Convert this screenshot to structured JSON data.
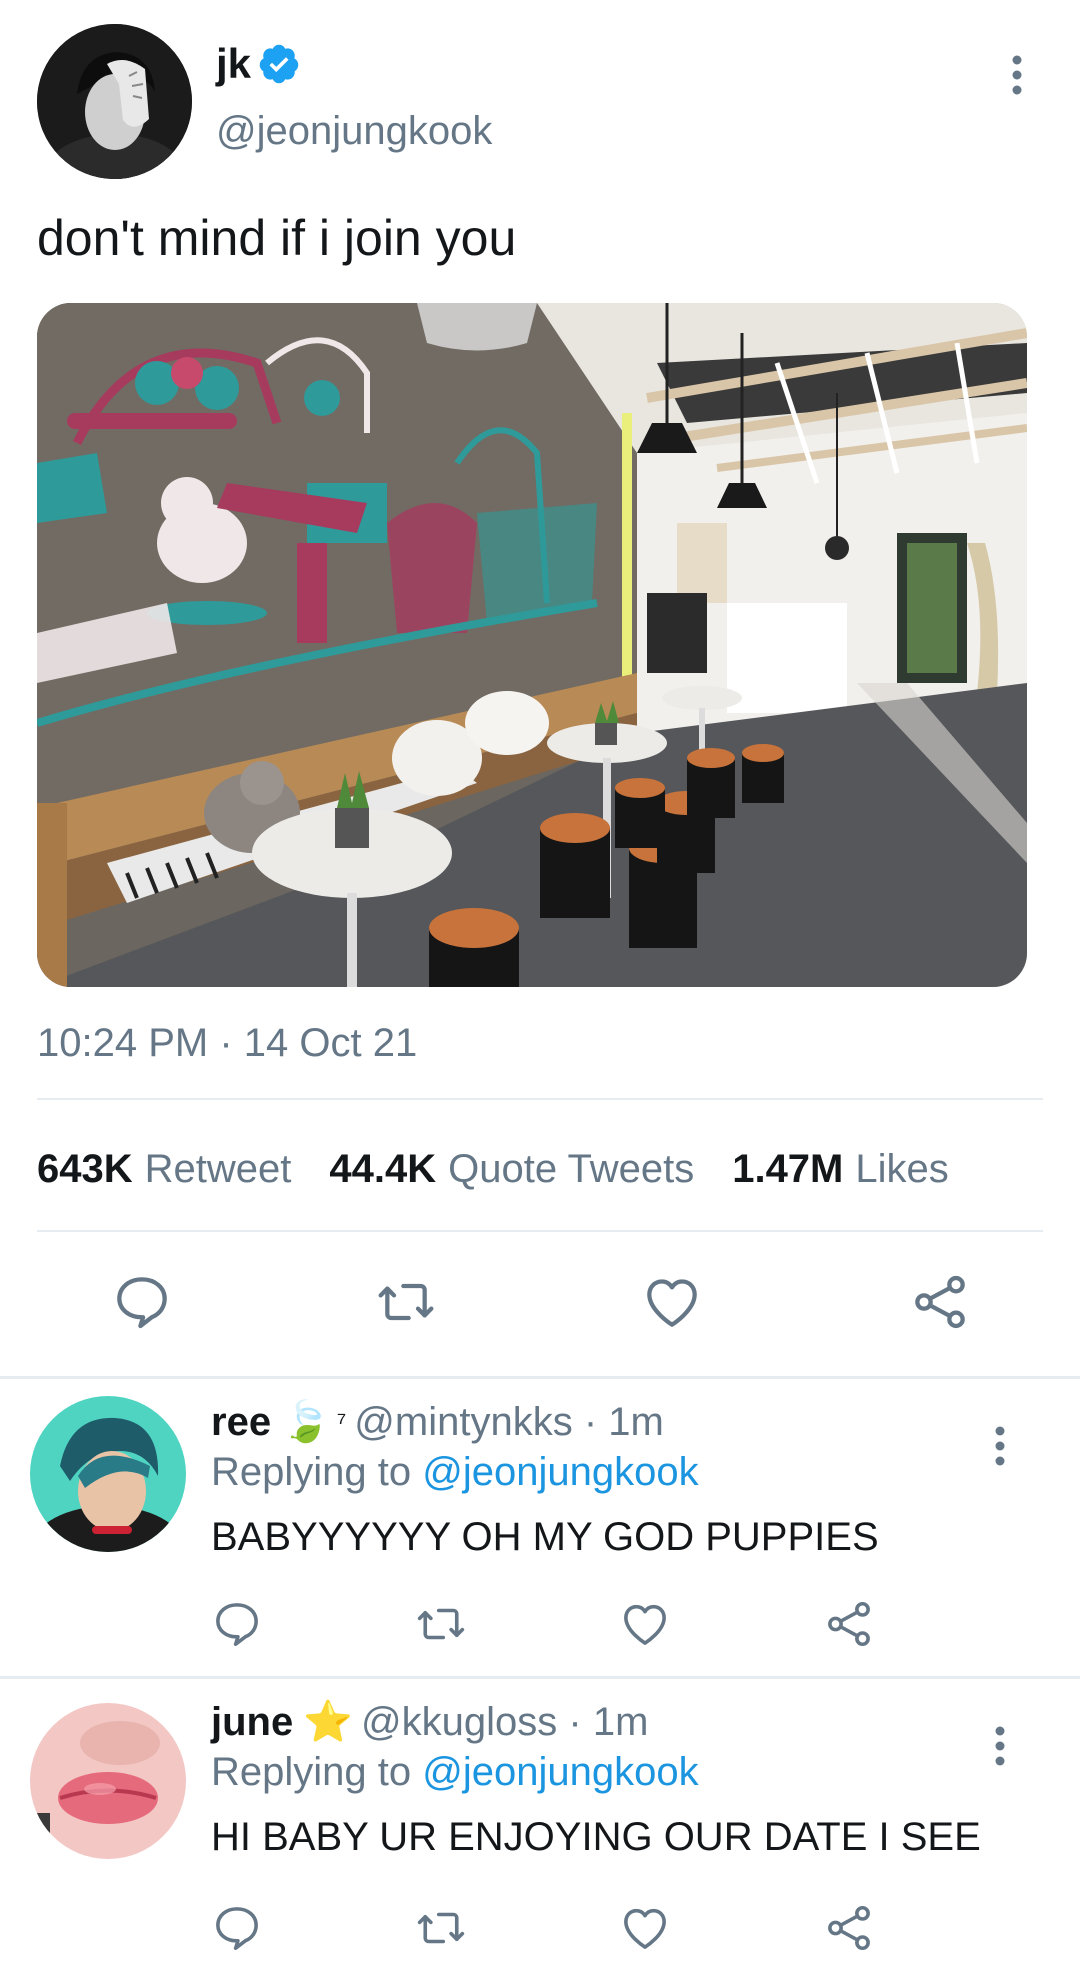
{
  "main_tweet": {
    "display_name": "jk",
    "verified_icon": "verified-badge-icon",
    "handle": "@jeonjungkook",
    "text": "don't mind if i join you",
    "timestamp": "10:24 PM · 14 Oct 21",
    "stats": {
      "retweets_count": "643K",
      "retweets_label": "Retweet",
      "quotes_count": "44.4K",
      "quotes_label": "Quote Tweets",
      "likes_count": "1.47M",
      "likes_label": "Likes"
    },
    "actions": [
      "reply-icon",
      "retweet-icon",
      "like-icon",
      "share-icon"
    ]
  },
  "replies": [
    {
      "display_name": "ree",
      "badge": "🍃",
      "badge_suffix": "⁷",
      "handle_time": "@mintynkks · 1m",
      "replying_prefix": "Replying to",
      "replying_mention": "@jeonjungkook",
      "text": "BABYYYYYY OH MY GOD PUPPIES"
    },
    {
      "display_name": "june",
      "badge": "⭐",
      "badge_suffix": "",
      "handle_time": "@kkugloss · 1m",
      "replying_prefix": "Replying to",
      "replying_mention": "@jeonjungkook",
      "text": "HI BABY UR ENJOYING OUR DATE I SEE"
    }
  ],
  "colors": {
    "text_primary": "#14171a",
    "text_secondary": "#657786",
    "link": "#1b95e0",
    "verified": "#1da1f2",
    "divider": "#e6ecf0"
  }
}
